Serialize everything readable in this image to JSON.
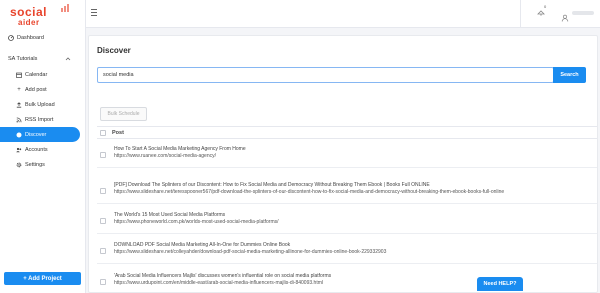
{
  "brand": {
    "logo_main": "social",
    "logo_sub": "aider",
    "accent": "#1a8cf0",
    "logo_color": "#e8442c"
  },
  "sidebar": {
    "dashboard": {
      "label": "Dashboard",
      "icon": "dashboard-icon"
    },
    "group": {
      "label": "SA Tutorials",
      "icon": "chevron-up-icon"
    },
    "items": [
      {
        "label": "Calendar",
        "icon": "calendar-icon"
      },
      {
        "label": "Add post",
        "icon": "plus-icon"
      },
      {
        "label": "Bulk Upload",
        "icon": "upload-icon"
      },
      {
        "label": "RSS Import",
        "icon": "rss-icon"
      },
      {
        "label": "Discover",
        "icon": "globe-icon",
        "active": true
      },
      {
        "label": "Accounts",
        "icon": "accounts-icon"
      },
      {
        "label": "Settings",
        "icon": "gear-icon"
      }
    ],
    "add_project_label": "+ Add Project"
  },
  "topbar": {
    "notification_count": "0"
  },
  "main": {
    "title": "Discover",
    "search_value": "social media",
    "search_button": "Search",
    "bulk_schedule_label": "Bulk Schedule",
    "column_header": "Post",
    "rows": [
      {
        "title": "How To Start A Social Media Marketing Agency From Home",
        "url": "https://www.ruanee.com/social-media-agency/"
      },
      {
        "title": "[PDF] Download The Splinters of our Discontent: How to Fix Social Media and Democracy Without Breaking Them Ebook | Books Full ONLINE",
        "url": "https://www.slideshare.net/teresspooner567/pdf-download-the-splinters-of-our-discontent-how-to-fix-social-media-and-democracy-without-breaking-them-ebook-books-full-online"
      },
      {
        "title": "The World's 15 Most Used Social Media Platforms",
        "url": "https://www.phoneworld.com.pk/worlds-most-used-social-media-platforms/"
      },
      {
        "title": "DOWNLOAD PDF Social Media Marketing All-In-One for Dummies Online Book",
        "url": "https://www.slideshare.net/colleyahder/download-pdf-social-media-marketing-allinone-for-dummies-online-book-229332903"
      },
      {
        "title": "'Arab Social Media Influencers Majlis' discusses women's influential role on social media platforms",
        "url": "https://www.urdupoint.com/en/middle-east/arab-social-media-influencers-majlis-di-840093.html"
      }
    ]
  },
  "help_label": "Need HELP?"
}
